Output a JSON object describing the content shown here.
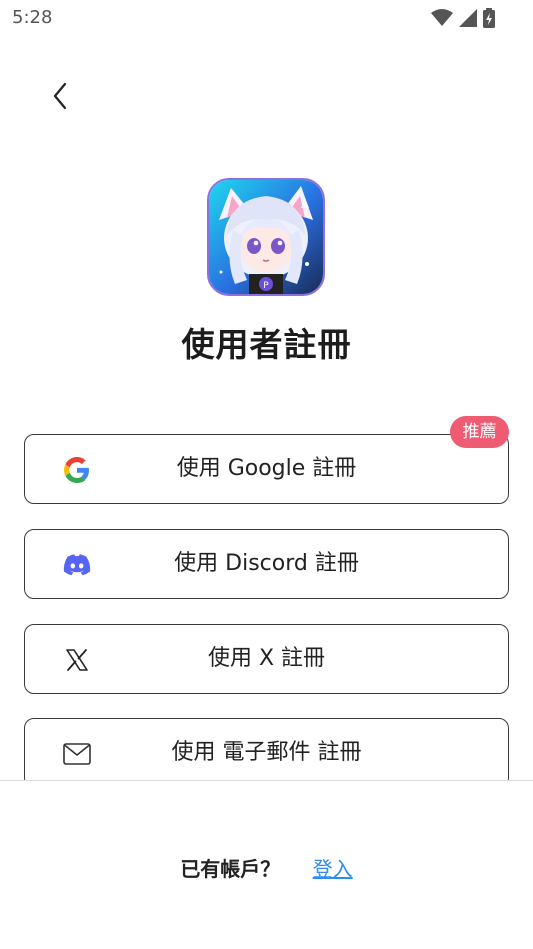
{
  "status_bar": {
    "time": "5:28",
    "icons": [
      "wifi-icon",
      "cell-signal-icon",
      "battery-charging-icon"
    ]
  },
  "header": {
    "back_icon": "chevron-left-icon"
  },
  "app": {
    "icon": "app-logo-avatar",
    "title": "使用者註冊"
  },
  "badge": {
    "label": "推薦",
    "color": "#ef5b73"
  },
  "signup_options": [
    {
      "icon": "google-icon",
      "label": "使用 Google 註冊"
    },
    {
      "icon": "discord-icon",
      "label": "使用 Discord 註冊"
    },
    {
      "icon": "x-icon",
      "label": "使用 X 註冊"
    },
    {
      "icon": "mail-icon",
      "label": "使用 電子郵件 註冊"
    }
  ],
  "footer": {
    "question": "已有帳戶？",
    "login_link": "登入",
    "link_color": "#2f8cf5"
  }
}
